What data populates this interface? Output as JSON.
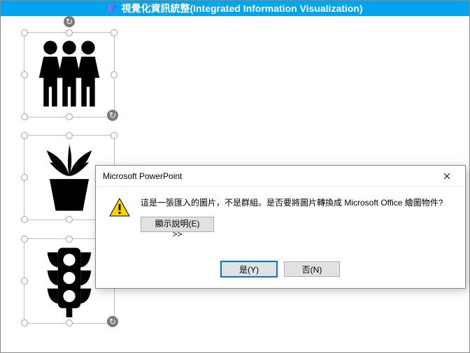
{
  "titlebar": {
    "text": "視覺化資訊統整(Integrated Information Visualization)"
  },
  "shapes": {
    "people_alt": "people-group-icon",
    "plant_alt": "potted-plant-icon",
    "traffic_alt": "traffic-light-icon"
  },
  "dialog": {
    "title": "Microsoft PowerPoint",
    "message": "這是一張匯入的圖片，不是群組。是否要將圖片轉換成 Microsoft Office 繪圖物件?",
    "expand_label": "顯示說明(E) >>",
    "yes_label": "是(Y)",
    "no_label": "否(N)"
  }
}
